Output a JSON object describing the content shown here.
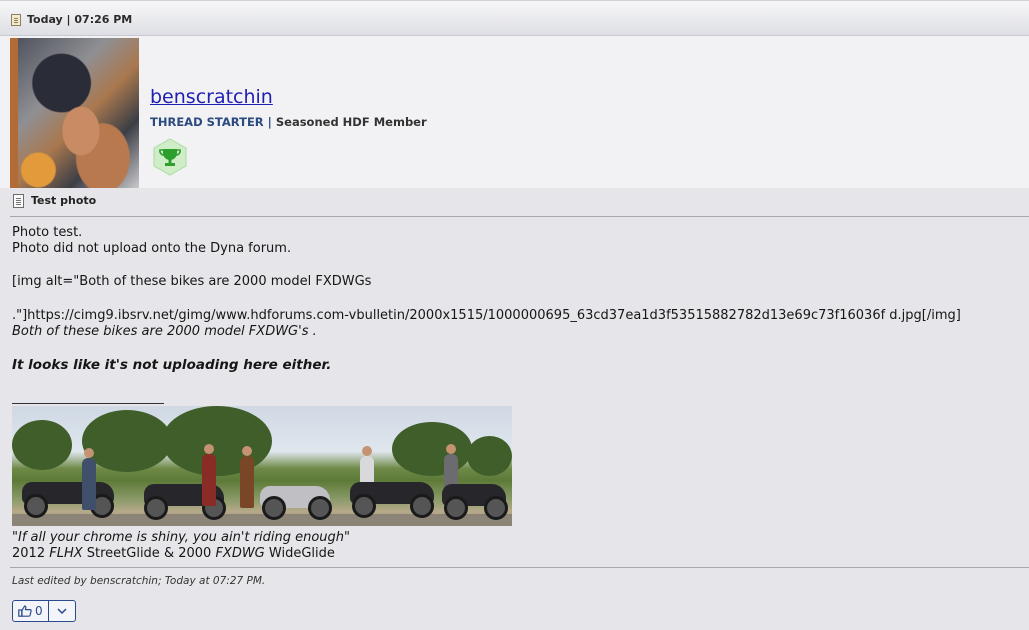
{
  "post": {
    "date": "Today | 07:26 PM",
    "title": "Test photo"
  },
  "author": {
    "username": "benscratchin",
    "role": "THREAD STARTER",
    "separator": "|",
    "rank": "Seasoned HDF Member",
    "award_icon": "trophy-icon"
  },
  "content": {
    "lines": [
      "Photo test.",
      "Photo did not upload onto the Dyna forum.",
      "[img alt=\"Both of these bikes are 2000 model FXDWGs",
      ".\"]https://cimg9.ibsrv.net/gimg/www.hdforums.com-vbulletin/2000x1515/1000000695_63cd37ea1d3f53515882782d13e69c73f16036f d.jpg[/img]",
      "Both of these bikes are 2000 model FXDWG's .",
      "It looks like it's not uploading here either."
    ]
  },
  "signature": {
    "quote": "\"If all your chrome is shiny, you ain't riding enough\"",
    "bikes_prefix": "2012 ",
    "bike1_model": "FLHX",
    "bike1_name": " StreetGlide & 2000 ",
    "bike2_model": "FXDWG",
    "bike2_name": " WideGlide"
  },
  "footer": {
    "edited": "Last edited by benscratchin; Today at 07:27 PM.",
    "like_count": "0"
  },
  "colors": {
    "link": "#1f1fb5",
    "role": "#2b4a7e",
    "button": "#2b4a8c",
    "award": "#2e9e2e"
  }
}
